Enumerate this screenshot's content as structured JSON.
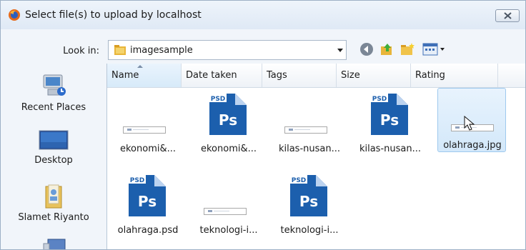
{
  "dialog": {
    "title": "Select file(s) to upload by localhost"
  },
  "lookin": {
    "label": "Look in:",
    "value": "imagesample"
  },
  "places": [
    {
      "label": "Recent Places",
      "icon": "recent-places-icon"
    },
    {
      "label": "Desktop",
      "icon": "desktop-icon"
    },
    {
      "label": "Slamet Riyanto",
      "icon": "user-folder-icon"
    },
    {
      "label": "",
      "icon": "computer-icon"
    }
  ],
  "columns": [
    "Name",
    "Date taken",
    "Tags",
    "Size",
    "Rating"
  ],
  "files": [
    {
      "name": "ekonomi&...",
      "type": "image"
    },
    {
      "name": "ekonomi&...",
      "type": "psd"
    },
    {
      "name": "kilas-nusan...",
      "type": "image"
    },
    {
      "name": "kilas-nusan...",
      "type": "psd"
    },
    {
      "name": "olahraga.jpg",
      "type": "image",
      "selected": true
    },
    {
      "name": "olahraga.psd",
      "type": "psd"
    },
    {
      "name": "teknologi-i...",
      "type": "image"
    },
    {
      "name": "teknologi-i...",
      "type": "psd"
    }
  ],
  "psd_icon": {
    "badge": "PSD",
    "glyph": "Ps"
  },
  "colors": {
    "accent": "#3a7bd5",
    "psd_blue": "#1c5fad",
    "selection": "#d3e8fa"
  }
}
